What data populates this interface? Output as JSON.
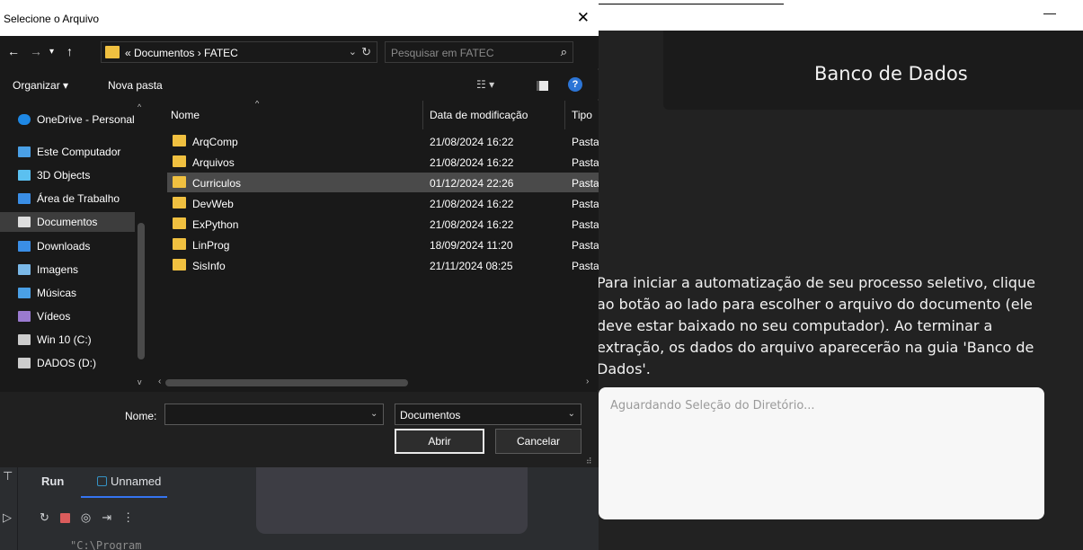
{
  "dialog": {
    "title": "Selecione o Arquivo",
    "address_path": "« Documentos › FATEC",
    "search_placeholder": "Pesquisar em FATEC",
    "organize_label": "Organizar ▾",
    "new_folder_label": "Nova pasta",
    "sidebar": [
      {
        "label": "OneDrive - Personal",
        "icon": "cloud-icon",
        "color": "#1e88e5"
      },
      {
        "label": "Este Computador",
        "icon": "computer-icon",
        "color": "#4aa0e6"
      },
      {
        "label": "3D Objects",
        "icon": "cube-icon",
        "color": "#5bc0f0"
      },
      {
        "label": "Área de Trabalho",
        "icon": "desktop-icon",
        "color": "#3a8ee6"
      },
      {
        "label": "Documentos",
        "icon": "document-icon",
        "color": "#dddddd",
        "selected": true
      },
      {
        "label": "Downloads",
        "icon": "download-icon",
        "color": "#3a8ee6"
      },
      {
        "label": "Imagens",
        "icon": "images-icon",
        "color": "#7ab8e8"
      },
      {
        "label": "Músicas",
        "icon": "music-icon",
        "color": "#4aa0e6"
      },
      {
        "label": "Vídeos",
        "icon": "video-icon",
        "color": "#9a7ad0"
      },
      {
        "label": "Win 10 (C:)",
        "icon": "drive-windows-icon",
        "color": "#cccccc"
      },
      {
        "label": "DADOS (D:)",
        "icon": "drive-icon",
        "color": "#cccccc"
      }
    ],
    "columns": {
      "name": "Nome",
      "date": "Data de modificação",
      "type": "Tipo"
    },
    "files": [
      {
        "name": "ArqComp",
        "date": "21/08/2024 16:22",
        "type": "Pasta"
      },
      {
        "name": "Arquivos",
        "date": "21/08/2024 16:22",
        "type": "Pasta"
      },
      {
        "name": "Curriculos",
        "date": "01/12/2024 22:26",
        "type": "Pasta",
        "selected": true
      },
      {
        "name": "DevWeb",
        "date": "21/08/2024 16:22",
        "type": "Pasta"
      },
      {
        "name": "ExPython",
        "date": "21/08/2024 16:22",
        "type": "Pasta"
      },
      {
        "name": "LinProg",
        "date": "18/09/2024 11:20",
        "type": "Pasta"
      },
      {
        "name": "SisInfo",
        "date": "21/11/2024 08:25",
        "type": "Pasta"
      }
    ],
    "filename_label": "Nome:",
    "filename_value": "",
    "filter_value": "Documentos",
    "open_label": "Abrir",
    "cancel_label": "Cancelar"
  },
  "app": {
    "header_title": "Banco de Dados",
    "instructions": "Para iniciar a automatização de seu processo seletivo, clique ao botão ao lado para escolher o arquivo do documento (ele deve estar baixado no seu computador). Ao terminar a extração, os dados do arquivo aparecerão na guia 'Banco de Dados'.",
    "directory_status": "Aguardando Seleção do Diretório..."
  },
  "ide": {
    "run_tab": "Run",
    "unnamed_tab": "Unnamed",
    "console_text": "\"C:\\Program"
  }
}
